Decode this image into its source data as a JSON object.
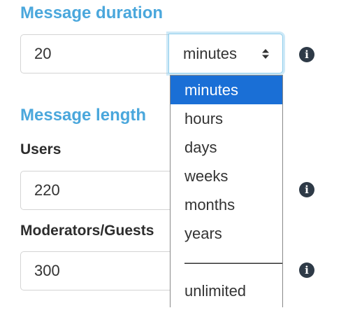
{
  "duration": {
    "title": "Message duration",
    "value": "20",
    "unit_selected": "minutes",
    "unit_options": [
      "minutes",
      "hours",
      "days",
      "weeks",
      "months",
      "years"
    ],
    "separator": "———————",
    "unit_extra_option": "unlimited",
    "info_glyph": "i"
  },
  "length": {
    "title": "Message length",
    "users_label": "Users",
    "users_value": "220",
    "moderators_label": "Moderators/Guests",
    "moderators_value": "300",
    "info_glyph": "i"
  },
  "icons": {
    "info": "info-circle-icon",
    "select_arrows": "sort-arrows-icon"
  },
  "colors": {
    "section_title": "#4aa7dc",
    "selected_option_bg": "#1a6fd6",
    "focus_ring": "#8fcdec",
    "info_icon_bg": "#2e3a47"
  }
}
